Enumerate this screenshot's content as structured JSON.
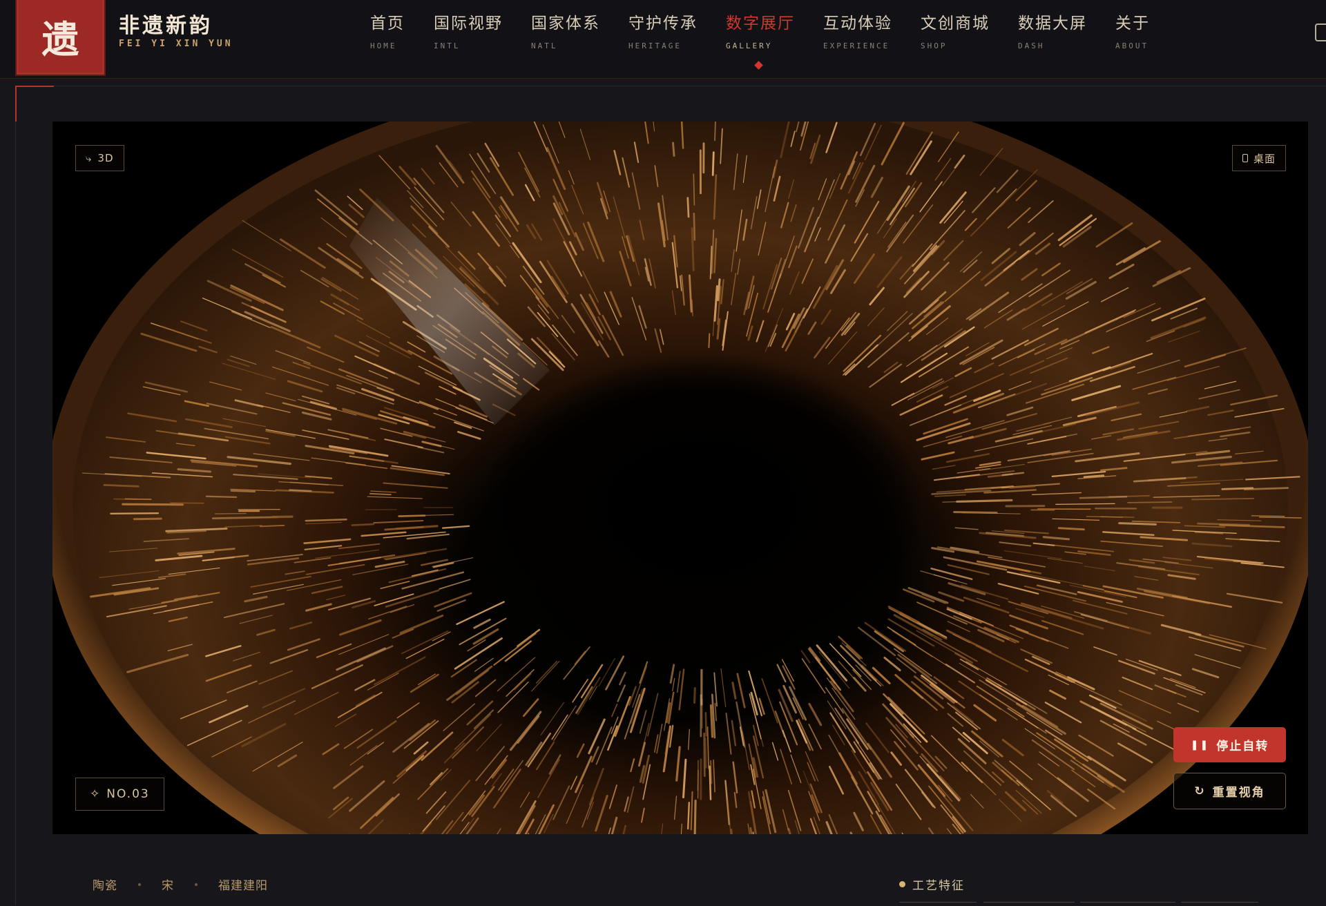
{
  "brand": {
    "logo_char": "遗",
    "name": "非遗新韵",
    "subtitle": "FEI YI XIN YUN"
  },
  "nav": [
    {
      "cn": "首页",
      "en": "HOME"
    },
    {
      "cn": "国际视野",
      "en": "INTL"
    },
    {
      "cn": "国家体系",
      "en": "NATL"
    },
    {
      "cn": "守护传承",
      "en": "HERITAGE"
    },
    {
      "cn": "数字展厅",
      "en": "GALLERY",
      "active": true
    },
    {
      "cn": "互动体验",
      "en": "EXPERIENCE"
    },
    {
      "cn": "文创商城",
      "en": "SHOP"
    },
    {
      "cn": "数据大屏",
      "en": "DASH"
    },
    {
      "cn": "关于",
      "en": "ABOUT"
    }
  ],
  "viewer": {
    "mode_label": "3D",
    "device_label": "桌面",
    "item_number": "NO.03",
    "stop_rotate_label": "停止自转",
    "reset_view_label": "重置视角"
  },
  "meta": {
    "category": "陶瓷",
    "dynasty": "宋",
    "origin": "福建建阳"
  },
  "features": {
    "title": "工艺特征"
  },
  "colors": {
    "accent_red": "#c2352c",
    "nav_active": "#d2372f",
    "gold": "#c8a46c",
    "background": "#17161b"
  }
}
